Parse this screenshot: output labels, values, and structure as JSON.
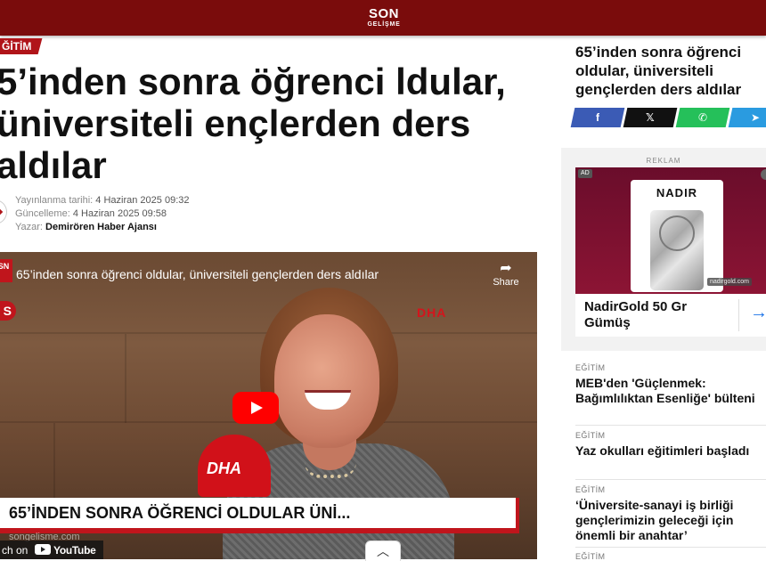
{
  "header": {
    "logo_line1": "SON",
    "logo_line2": "GELİŞME",
    "bg_color": "#7a0c0c"
  },
  "article": {
    "category": "ĞİTİM",
    "headline": "5’inden sonra öğrenci ldular, üniversiteli ençlerden ders aldılar",
    "published_label": "Yayınlanma tarihi:",
    "published_value": "4 Haziran 2025 09:32",
    "updated_label": "Güncelleme:",
    "updated_value": "4 Haziran 2025 09:58",
    "author_label": "Yazar:",
    "author_value": "Demirören Haber Ajansı"
  },
  "video": {
    "logo_text": "SN",
    "title": "65’inden sonra öğrenci oldular, üniversiteli gençlerden ders aldılar",
    "share_label": "Share",
    "side_badge": "S",
    "dha_label": "DHA",
    "mic_label": "DHA",
    "caption": "65’İNDEN SONRA ÖĞRENCİ OLDULAR ÜNİ...",
    "watermark": "songelisme.com",
    "watch_on": "ch on",
    "youtube_label": "YouTube"
  },
  "sidebar": {
    "title": "65’inden sonra öğrenci oldular, üniversiteli gençlerden ders aldılar",
    "share_buttons": [
      {
        "icon": "facebook-icon",
        "glyph": "f",
        "color": "#3b5bb5"
      },
      {
        "icon": "x-icon",
        "glyph": "𝕏",
        "color": "#111111"
      },
      {
        "icon": "whatsapp-icon",
        "glyph": "✆",
        "color": "#25c05a"
      },
      {
        "icon": "telegram-icon",
        "glyph": "➤",
        "color": "#2a9be0"
      }
    ],
    "ad": {
      "label": "REKLAM",
      "tag": "AD",
      "brand": "NADIR",
      "site": "nadirgold.com",
      "name": "NadirGold 50 Gr Gümüş"
    },
    "news": [
      {
        "category": "EĞİTİM",
        "title": "MEB'den 'Güçlenmek: Bağımlılıktan Esenliğe' bülteni"
      },
      {
        "category": "EĞİTİM",
        "title": "Yaz okulları eğitimleri başladı"
      },
      {
        "category": "EĞİTİM",
        "title": "‘Üniversite-sanayi iş birliği gençlerimizin geleceği için önemli bir anahtar’"
      },
      {
        "category": "EĞİTİM",
        "title": ""
      }
    ]
  }
}
